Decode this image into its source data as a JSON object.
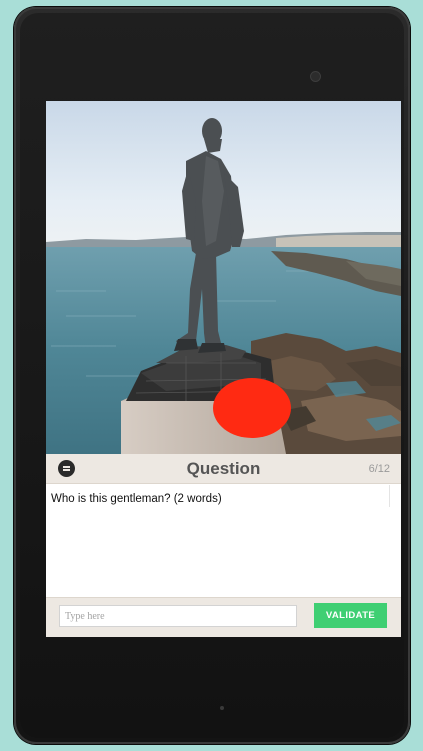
{
  "device": {
    "camera_icon": "camera-icon"
  },
  "question_header": {
    "menu_icon": "menu-icon",
    "title": "Question",
    "counter": "6/12"
  },
  "question": {
    "text": "Who is this gentleman? (2 words)"
  },
  "answer": {
    "placeholder": "Type here",
    "value": "",
    "validate_label": "VALIDATE"
  },
  "colors": {
    "background": "#a9ded7",
    "validate_button": "#3fcf73",
    "header_bar": "#ede8e2",
    "marker": "#ff2a12"
  },
  "photo": {
    "subject": "statue of a man on a stone pedestal by the sea",
    "marker_icon": "red-circle-marker"
  }
}
